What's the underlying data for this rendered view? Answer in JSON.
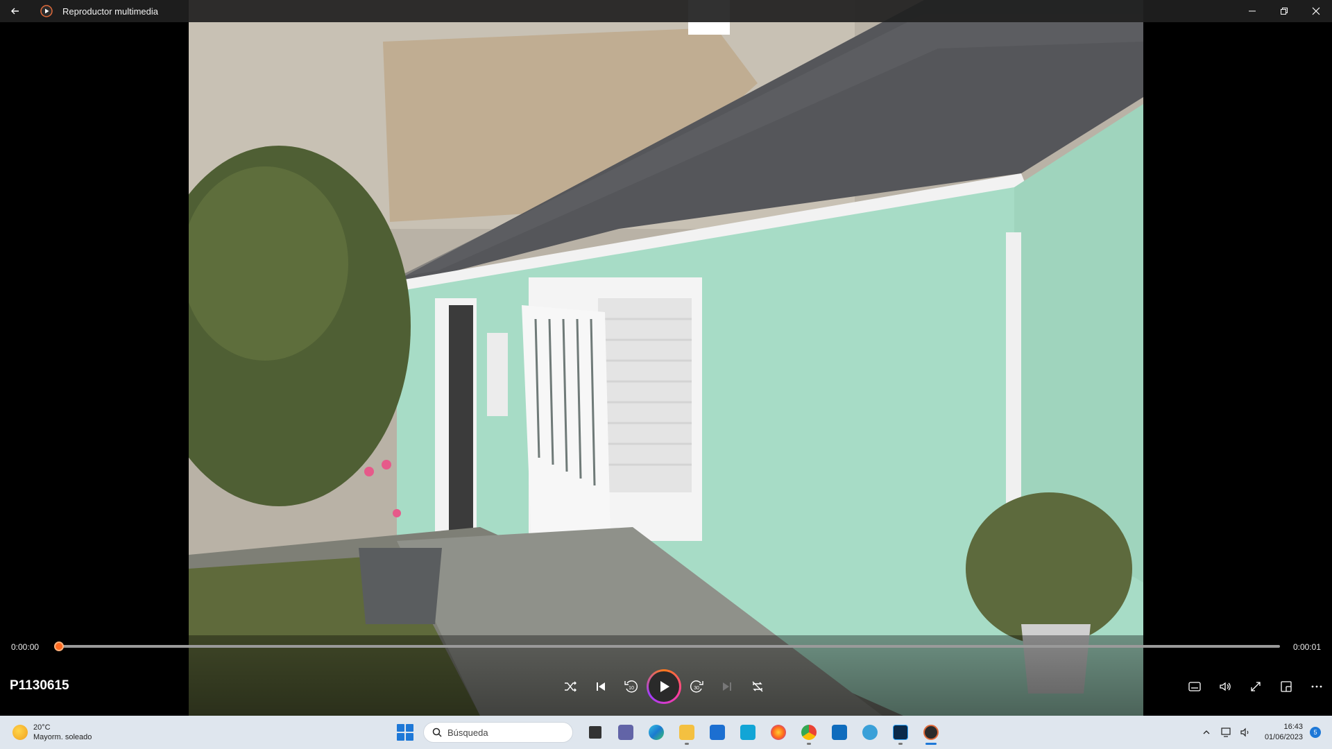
{
  "window": {
    "title": "Reproductor multimedia"
  },
  "player": {
    "media_title": "P1130615",
    "current_time": "0:00:00",
    "total_time": "0:00:01",
    "progress": 0.0,
    "accent_color": "#ff6a20"
  },
  "controls": {
    "center": [
      "shuffle-icon",
      "previous-icon",
      "rewind-10-icon",
      "play-icon",
      "forward-30-icon",
      "next-icon",
      "repeat-icon"
    ],
    "right": [
      "subtitles-icon",
      "volume-icon",
      "fullscreen-icon",
      "miniplayer-icon",
      "more-icon"
    ]
  },
  "taskbar": {
    "weather_temp": "20°C",
    "weather_desc": "Mayorm. soleado",
    "search_placeholder": "Búsqueda",
    "apps": [
      "task-view",
      "teams",
      "edge",
      "file-explorer",
      "mail",
      "l-app",
      "firefox",
      "chrome",
      "outlook",
      "maps",
      "photoshop",
      "media-player"
    ],
    "time": "16:43",
    "date": "01/06/2023",
    "notification_count": "5"
  }
}
